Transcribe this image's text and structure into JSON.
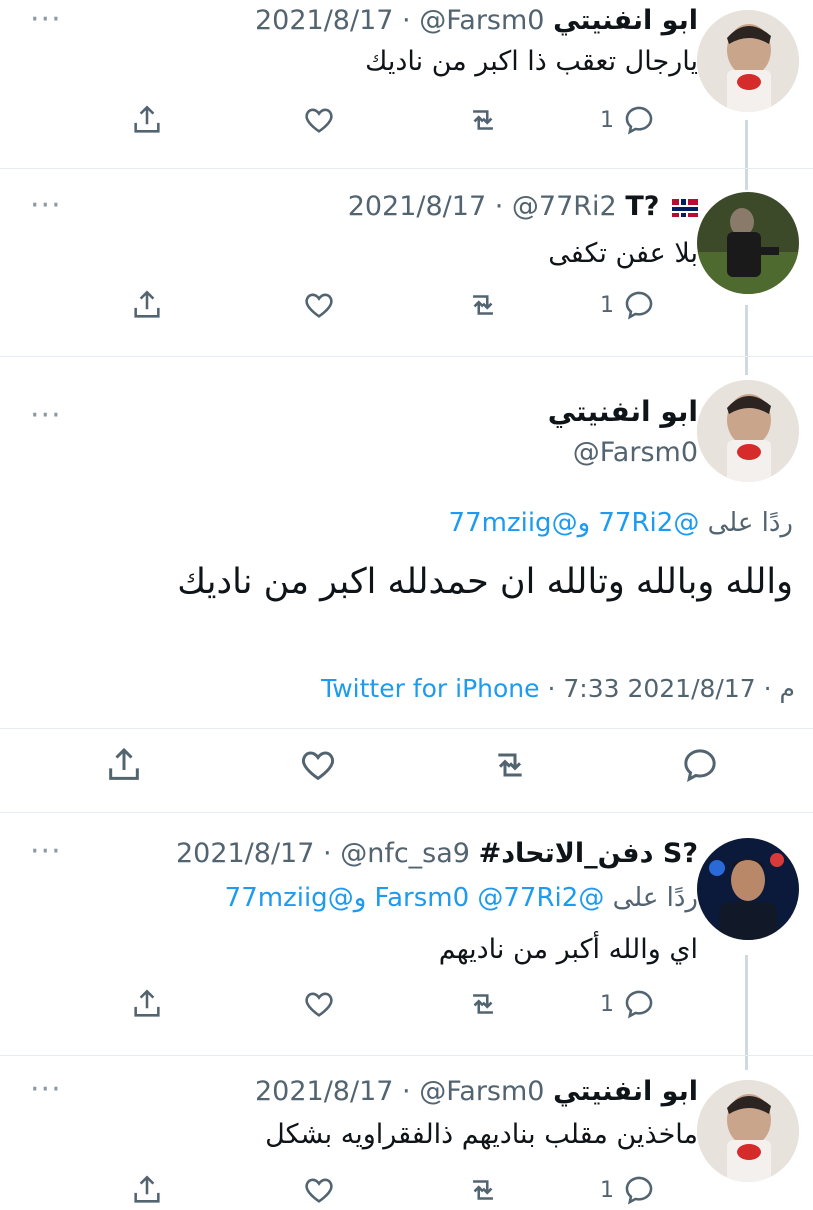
{
  "tweets": [
    {
      "name": "ابو انفنيتي",
      "handle": "@Farsm0",
      "date": "2021/8/17",
      "text": "يارجال تعقب ذا اكبر من ناديك",
      "reply_count": "1"
    },
    {
      "name": "T?",
      "handle": "@77Ri2",
      "date": "2021/8/17",
      "text": "بلا عفن تكفى",
      "reply_count": "1"
    },
    {
      "name": "#دفن_الاتحاد S?",
      "handle": "@nfc_sa9",
      "date": "2021/8/17",
      "reply_prefix": "ردًا على",
      "reply_handles": "@Farsm0 @77Ri2 و@77mziig",
      "text": "اي والله أكبر من ناديهم",
      "reply_count": "1"
    },
    {
      "name": "ابو انفنيتي",
      "handle": "@Farsm0",
      "date": "2021/8/17",
      "text": "ماخذين مقلب بناديهم ذالفقراويه بشكل",
      "reply_count": "1"
    }
  ],
  "main_tweet": {
    "name": "ابو انفنيتي",
    "handle": "@Farsm0",
    "reply_prefix": "ردًا على",
    "reply_handles": "@77Ri2 و@77mziig",
    "text": "والله وبالله وتالله ان حمدلله اكبر من ناديك",
    "date": "2021/8/17",
    "time": "7:33 م",
    "source": "Twitter for iPhone"
  },
  "sep": "·",
  "more": "···",
  "icons": {
    "reply": "reply-icon",
    "retweet": "retweet-icon",
    "like": "like-icon",
    "share": "share-icon",
    "more": "more-icon"
  },
  "colors": {
    "link": "#1d9bf0",
    "meta": "#536471",
    "thread_line": "#cfd9de"
  }
}
